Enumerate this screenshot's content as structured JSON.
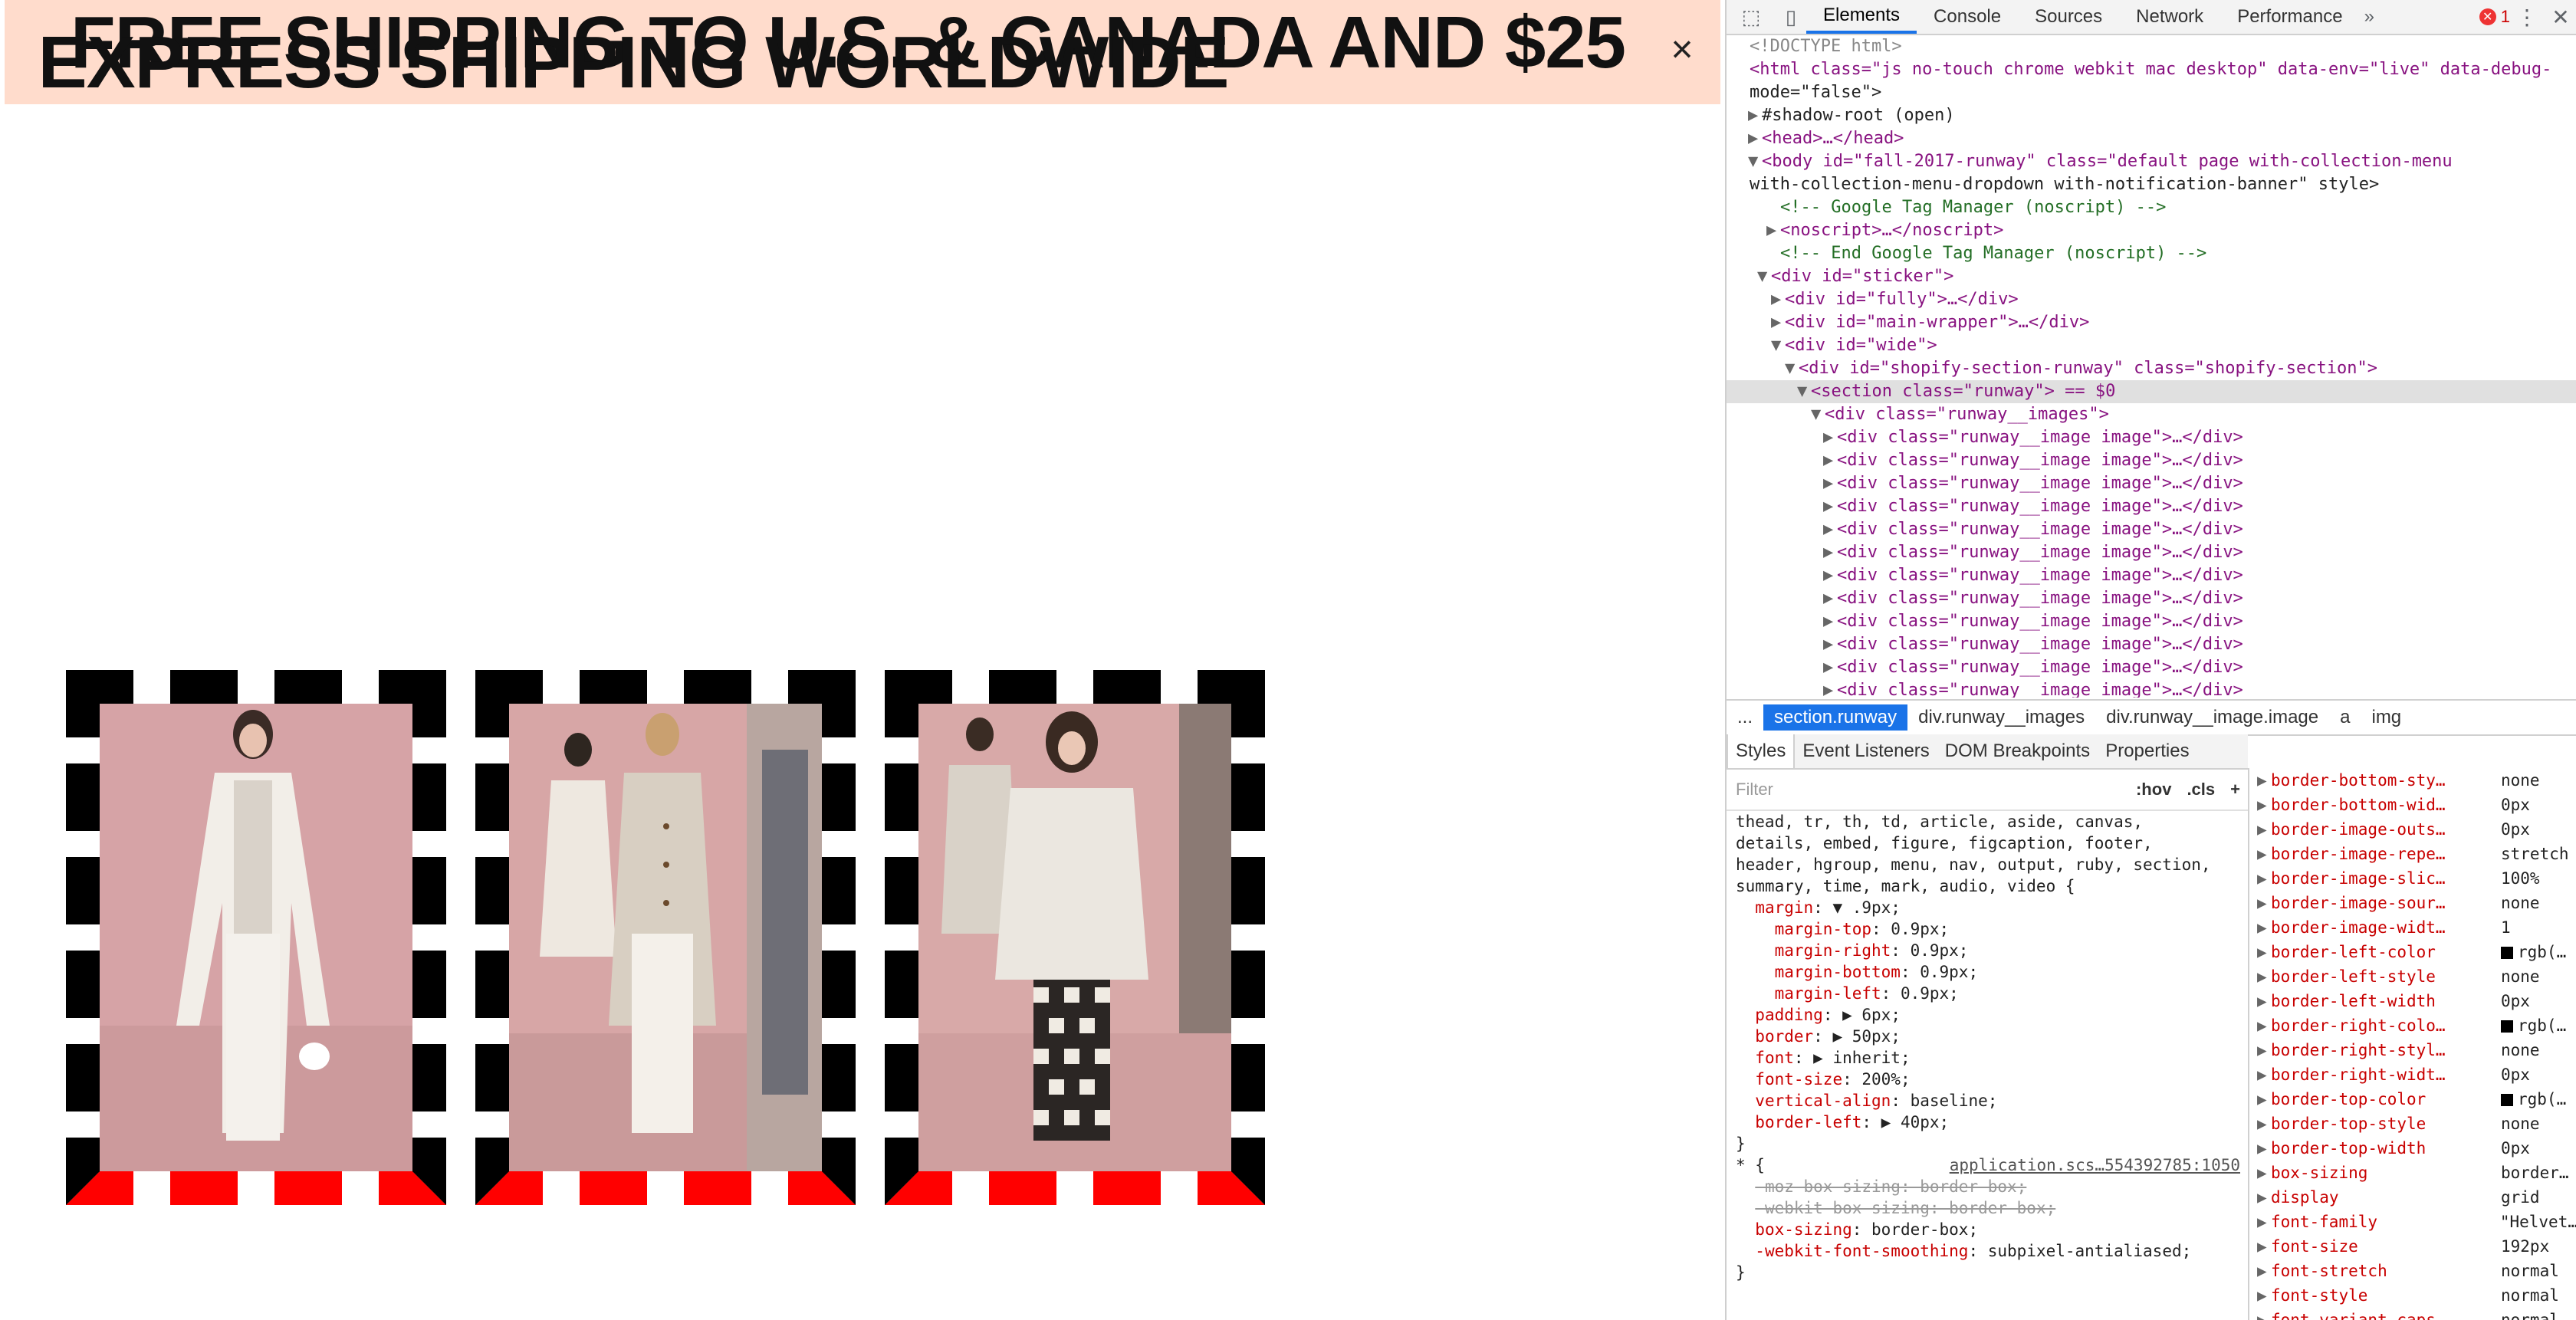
{
  "banner": {
    "line1": "FREE SHIPPING TO U.S. & CANADA AND $25",
    "line2": "EXPRESS SHIPPING WORLDWIDE",
    "close_symbol": "×",
    "background": "#ffdccc"
  },
  "runway": {
    "border_color": "#000000",
    "border_bottom_color": "#ff0000"
  },
  "devtools": {
    "tabs": [
      "Elements",
      "Console",
      "Sources",
      "Network",
      "Performance"
    ],
    "more": "»",
    "error_count": "1",
    "menu_symbol": "⋮",
    "close_symbol": "✕",
    "dom_lines": [
      "<!DOCTYPE html>",
      "<html class=\"js no-touch chrome webkit mac desktop\" data-env=\"live\" data-debug-",
      "mode=\"false\">",
      "#shadow-root (open)",
      "<head>…</head>",
      "<body id=\"fall-2017-runway\" class=\"default    page      with-collection-menu",
      "with-collection-menu-dropdown with-notification-banner\" style>",
      "<!-- Google Tag Manager (noscript) -->",
      "<noscript>…</noscript>",
      "<!-- End Google Tag Manager (noscript) -->",
      "<div id=\"sticker\">",
      "<div id=\"fully\">…</div>",
      "<div id=\"main-wrapper\">…</div>",
      "<div id=\"wide\">",
      "<div id=\"shopify-section-runway\" class=\"shopify-section\">",
      "<section class=\"runway\"> == $0",
      "<div class=\"runway__images\">",
      "<div class=\"runway__image image\">…</div>",
      "<div class=\"runway__image image\">…</div>",
      "<div class=\"runway__image image\">…</div>",
      "<div class=\"runway__image image\">…</div>",
      "<div class=\"runway__image image\">…</div>",
      "<div class=\"runway__image image\">…</div>",
      "<div class=\"runway__image image\">…</div>",
      "<div class=\"runway__image image\">…</div>",
      "<div class=\"runway__image image\">…</div>",
      "<div class=\"runway__image image\">…</div>",
      "<div class=\"runway__image image\">…</div>",
      "<div class=\"runway__image image\">…</div>"
    ],
    "breadcrumbs": [
      "...",
      "section.runway",
      "div.runway__images",
      "div.runway__image.image",
      "a",
      "img"
    ],
    "styles_tabs": [
      "Styles",
      "Event Listeners",
      "DOM Breakpoints",
      "Properties"
    ],
    "filter_placeholder": "Filter",
    "filter_hov": ":hov",
    "filter_cls": ".cls",
    "filter_add": "+",
    "styles_lines": [
      "thead, tr, th, td, article, aside, canvas,",
      "details, embed, figure, figcaption, footer,",
      "header, hgroup, menu, nav, output, ruby, section,",
      "summary, time, mark, audio, video {",
      "  margin: ▼ .9px;",
      "    margin-top: 0.9px;",
      "    margin-right: 0.9px;",
      "    margin-bottom: 0.9px;",
      "    margin-left: 0.9px;",
      "  padding: ▶ 6px;",
      "  border: ▶ 50px;",
      "  font: ▶ inherit;",
      "  font-size: 200%;",
      "  vertical-align: baseline;",
      "  border-left: ▶ 40px;",
      "}",
      "* {                          application.scs…554392785:1050",
      "  -moz-box-sizing: border-box;",
      "  -webkit-box-sizing: border-box;",
      "  box-sizing: border-box;",
      "  -webkit-font-smoothing: subpixel-antialiased;",
      "}"
    ],
    "computed": [
      {
        "name": "border-bottom-sty…",
        "value": "none"
      },
      {
        "name": "border-bottom-wid…",
        "value": "0px"
      },
      {
        "name": "border-image-outs…",
        "value": "0px"
      },
      {
        "name": "border-image-repe…",
        "value": "stretch"
      },
      {
        "name": "border-image-slic…",
        "value": "100%"
      },
      {
        "name": "border-image-sour…",
        "value": "none"
      },
      {
        "name": "border-image-widt…",
        "value": "1"
      },
      {
        "name": "border-left-color",
        "value": "rgb(…"
      },
      {
        "name": "border-left-style",
        "value": "none"
      },
      {
        "name": "border-left-width",
        "value": "0px"
      },
      {
        "name": "border-right-colo…",
        "value": "rgb(…"
      },
      {
        "name": "border-right-styl…",
        "value": "none"
      },
      {
        "name": "border-right-widt…",
        "value": "0px"
      },
      {
        "name": "border-top-color",
        "value": "rgb(…"
      },
      {
        "name": "border-top-style",
        "value": "none"
      },
      {
        "name": "border-top-width",
        "value": "0px"
      },
      {
        "name": "box-sizing",
        "value": "border…"
      },
      {
        "name": "display",
        "value": "grid"
      },
      {
        "name": "font-family",
        "value": "\"Helvet…"
      },
      {
        "name": "font-size",
        "value": "192px"
      },
      {
        "name": "font-stretch",
        "value": "normal"
      },
      {
        "name": "font-style",
        "value": "normal"
      },
      {
        "name": "font-variant-caps",
        "value": "normal"
      }
    ]
  }
}
